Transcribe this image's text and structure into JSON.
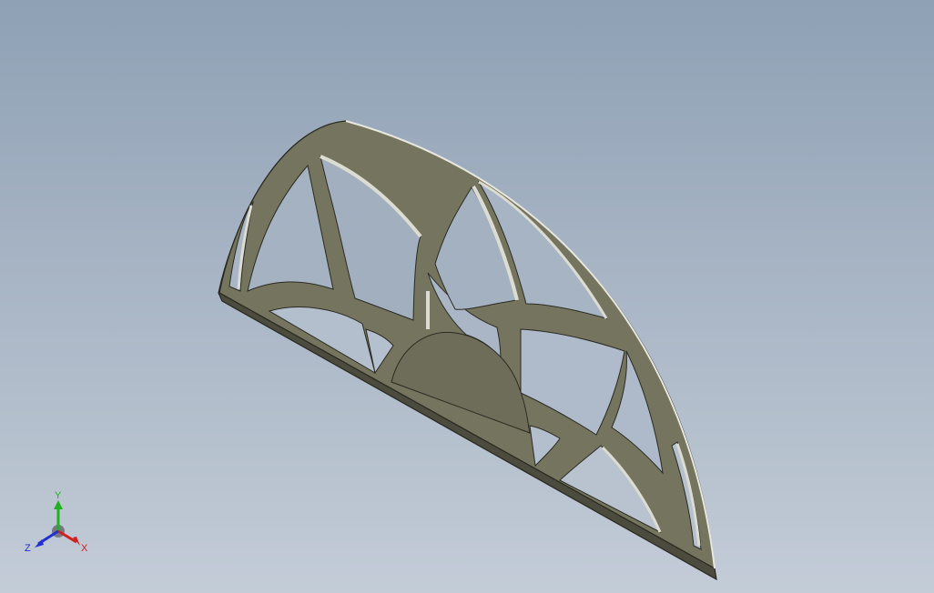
{
  "viewport": {
    "background_top": "#8ea1b5",
    "background_bottom": "#c3ccd7"
  },
  "model": {
    "part_face_color": "#72725e",
    "part_edge_color": "#2a2a22",
    "cutout_wall_color": "#dcdcd2"
  },
  "triad": {
    "x_label": "X",
    "y_label": "Y",
    "z_label": "Z",
    "x_color": "#d02020",
    "y_color": "#20b020",
    "z_color": "#2030d0"
  }
}
